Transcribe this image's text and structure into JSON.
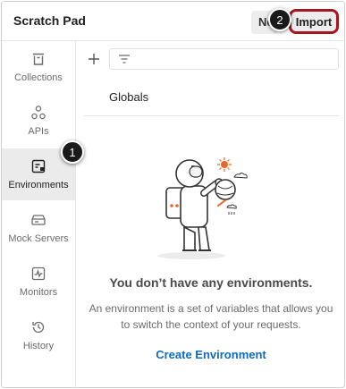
{
  "header": {
    "title": "Scratch Pad",
    "new_label": "New",
    "import_label": "Import"
  },
  "callouts": [
    "1",
    "2"
  ],
  "sidebar": {
    "items": [
      {
        "label": "Collections",
        "icon": "trash-can-icon"
      },
      {
        "label": "APIs",
        "icon": "api-icon"
      },
      {
        "label": "Environments",
        "icon": "environment-icon",
        "active": true
      },
      {
        "label": "Mock Servers",
        "icon": "server-icon"
      },
      {
        "label": "Monitors",
        "icon": "monitor-icon"
      },
      {
        "label": "History",
        "icon": "history-icon"
      }
    ]
  },
  "main": {
    "globals_label": "Globals",
    "empty_title": "You don’t have any environments.",
    "empty_description": "An environment is a set of variables that allows you to switch the context of your requests.",
    "create_link": "Create Environment"
  },
  "colors": {
    "accent_link": "#0c6bc4",
    "highlight_border": "#a3181f",
    "illustration_orange": "#e8672a"
  }
}
